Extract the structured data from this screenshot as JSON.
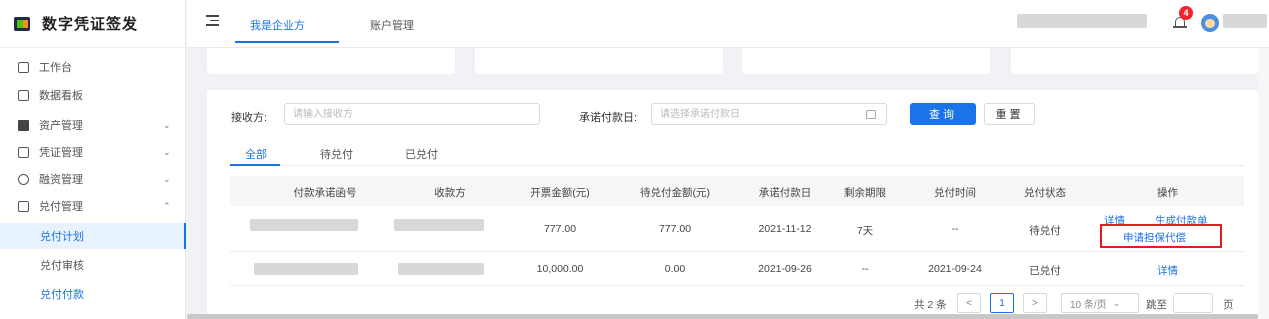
{
  "app": {
    "title": "数字凭证签发"
  },
  "sidebar": {
    "items": [
      {
        "label": "工作台",
        "icon": "monitor-icon"
      },
      {
        "label": "数据看板",
        "icon": "dashboard-icon"
      },
      {
        "label": "资产管理",
        "icon": "asset-icon",
        "expandable": true
      },
      {
        "label": "凭证管理",
        "icon": "voucher-icon",
        "expandable": true
      },
      {
        "label": "融资管理",
        "icon": "finance-icon",
        "expandable": true
      },
      {
        "label": "兑付管理",
        "icon": "payment-icon",
        "expandable": true,
        "expanded": true
      }
    ],
    "sub_items": [
      {
        "label": "兑付计划",
        "active": true
      },
      {
        "label": "兑付审核",
        "active": false
      },
      {
        "label": "兑付付款",
        "active": false
      }
    ]
  },
  "header": {
    "tabs": [
      "我是企业方",
      "账户管理"
    ],
    "notification_count": "4"
  },
  "search": {
    "receiver_label": "接收方:",
    "receiver_placeholder": "请输入接收方",
    "date_label": "承诺付款日:",
    "date_placeholder": "请选择承诺付款日",
    "query_label": "查询",
    "reset_label": "重置"
  },
  "filter_tabs": [
    "全部",
    "待兑付",
    "已兑付"
  ],
  "table": {
    "columns": [
      "付款承诺函号",
      "收款方",
      "开票金额(元)",
      "待兑付金额(元)",
      "承诺付款日",
      "剩余期限",
      "兑付时间",
      "兑付状态",
      "操作"
    ],
    "rows": [
      {
        "invoice_amount": "777.00",
        "pending_amount": "777.00",
        "due_date": "2021-11-12",
        "remaining": "7天",
        "paid_time": "--",
        "status": "待兑付",
        "actions": [
          "详情",
          "生成付款单",
          "申请担保代偿"
        ]
      },
      {
        "invoice_amount": "10,000.00",
        "pending_amount": "0.00",
        "due_date": "2021-09-26",
        "remaining": "--",
        "paid_time": "2021-09-24",
        "status": "已兑付",
        "actions": [
          "详情"
        ]
      }
    ]
  },
  "pagination": {
    "total": "共 2 条",
    "prev": "<",
    "current": "1",
    "next": ">",
    "page_size": "10 条/页",
    "jump_label": "跳至",
    "page_suffix": "页"
  },
  "colors": {
    "primary": "#1a73e8",
    "highlight": "#e02020",
    "badge": "#f5222d"
  }
}
